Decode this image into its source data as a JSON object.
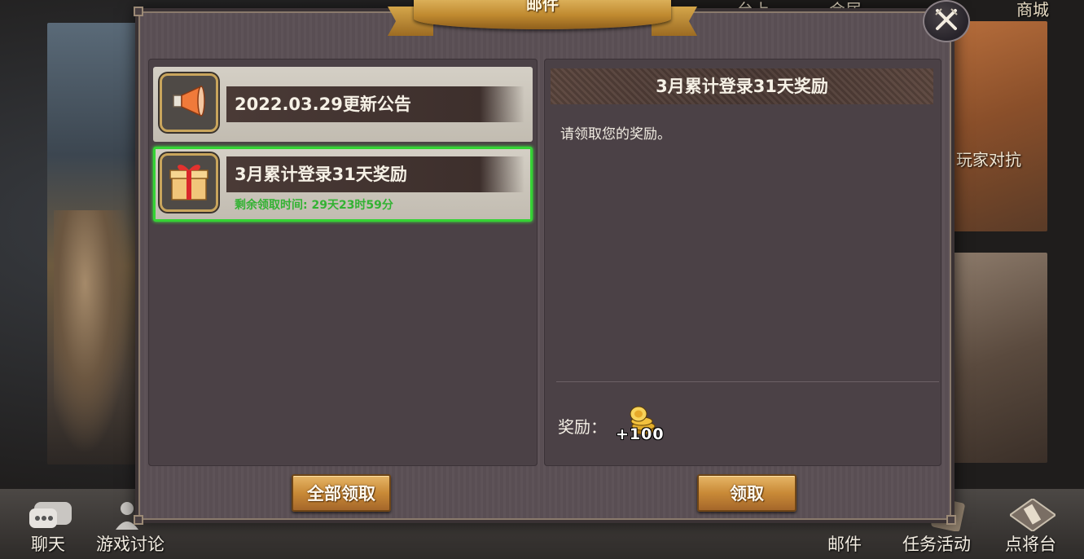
{
  "background": {
    "top_nav": [
      "台上",
      "会居",
      "商城"
    ],
    "right_card_label": "玩家对抗",
    "bottom_left": [
      {
        "label": "聊天",
        "icon": "chat-bubble-icon"
      },
      {
        "label": "游戏讨论",
        "icon": "discussion-users-icon"
      }
    ],
    "bottom_right": [
      {
        "label": "邮件",
        "icon": "mail-icon"
      },
      {
        "label": "任务活动",
        "icon": "quest-icon"
      },
      {
        "label": "点将台",
        "icon": "general-stage-icon"
      }
    ]
  },
  "dialog": {
    "title": "邮件",
    "close_icon": "close-crossed-swords-icon"
  },
  "mail_list": [
    {
      "icon": "megaphone-icon",
      "title": "2022.03.29更新公告",
      "expire": ""
    },
    {
      "icon": "gift-box-icon",
      "title": "3月累计登录31天奖励",
      "expire": "剩余领取时间: 29天23时59分",
      "selected": true
    }
  ],
  "detail": {
    "title": "3月累计登录31天奖励",
    "body": "请领取您的奖励。",
    "reward_label": "奖励：",
    "reward_icon": "gold-coins-icon",
    "reward_count": "+100"
  },
  "buttons": {
    "collect_all": "全部领取",
    "collect": "领取"
  },
  "colors": {
    "selected_border": "#35d335",
    "expire_text": "#33b233",
    "button_gold": "#c98a37"
  }
}
